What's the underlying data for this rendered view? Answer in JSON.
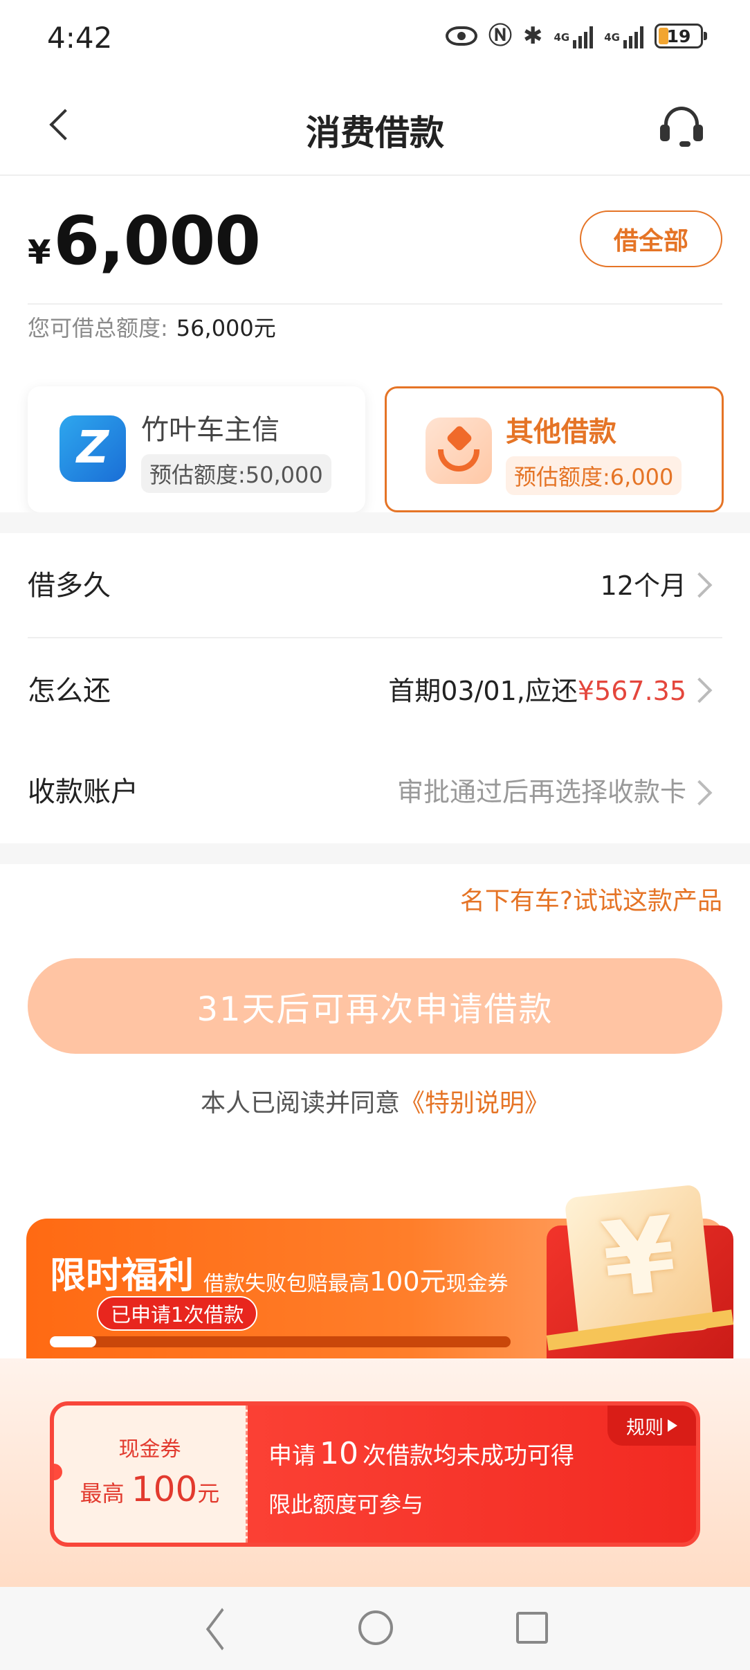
{
  "status_bar": {
    "time": "4:42",
    "network_1": "4G",
    "network_2": "4G",
    "battery": "19",
    "battery_color": "#f2a531",
    "icons": [
      "eye-icon",
      "nfc-icon",
      "bluetooth-icon",
      "signal-icon",
      "signal-icon",
      "battery-icon"
    ]
  },
  "header": {
    "title": "消费借款",
    "back_icon": "chevron-left-icon",
    "service_icon": "headset-icon"
  },
  "loan": {
    "currency": "¥",
    "amount": "6,000",
    "borrow_all_label": "借全部",
    "total_limit_label": "您可借总额度:",
    "total_limit_value": "56,000元"
  },
  "products": [
    {
      "name": "竹叶车主信",
      "quota": "预估额度:50,000",
      "selected": false
    },
    {
      "name": "其他借款",
      "quota": "预估额度:6,000",
      "selected": true
    }
  ],
  "rows": {
    "term": {
      "label": "借多久",
      "value": "12个月"
    },
    "repay": {
      "label": "怎么还",
      "value_prefix": "首期03/01,应还",
      "value_amount": "¥567.35"
    },
    "account": {
      "label": "收款账户",
      "value": "审批通过后再选择收款卡"
    }
  },
  "car_link": "名下有车?试试这款产品",
  "main_button": "31天后可再次申请借款",
  "agreement": {
    "text": "本人已阅读并同意",
    "link": "《特别说明》"
  },
  "promo": {
    "title": "限时福利",
    "subtitle_before": "借款失败包赔最高",
    "subtitle_amount": "100元",
    "subtitle_after": "现金券",
    "applied_badge": "已申请1次借款",
    "progress_fraction": 0.1
  },
  "coupon": {
    "type": "现金券",
    "max_prefix": "最高",
    "max_amount": "100",
    "max_unit": "元",
    "line1_before": "申请",
    "line1_count": "10",
    "line1_after": "次借款均未成功可得",
    "line2": "限此额度可参与",
    "rules_label": "规则"
  },
  "colors": {
    "accent": "#e57426",
    "price_red": "#e4463c",
    "button_disabled": "#ffc4a3"
  }
}
